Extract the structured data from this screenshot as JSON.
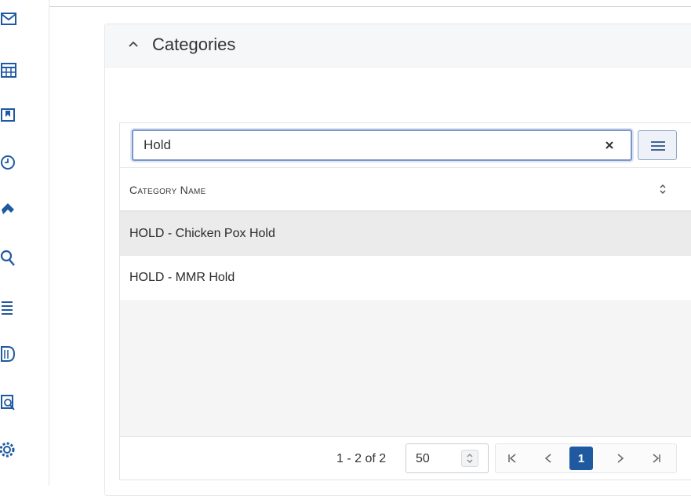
{
  "panel": {
    "title": "Categories"
  },
  "search": {
    "value": "Hold"
  },
  "grid": {
    "column_header": "Category Name",
    "rows": [
      {
        "name": "HOLD - Chicken Pox Hold"
      },
      {
        "name": "HOLD - MMR Hold"
      }
    ]
  },
  "pager": {
    "range": "1 - 2 of 2",
    "page_size": "50",
    "current_page": "1"
  },
  "colors": {
    "accent": "#1f5aa0",
    "selected_row": "#ebebeb"
  },
  "rail_icons": [
    "mail-icon",
    "calendar-icon",
    "bookmark-icon",
    "clock-icon",
    "tag-icon",
    "search-icon",
    "list-icon",
    "document-icon",
    "report-search-icon",
    "gear-icon"
  ]
}
